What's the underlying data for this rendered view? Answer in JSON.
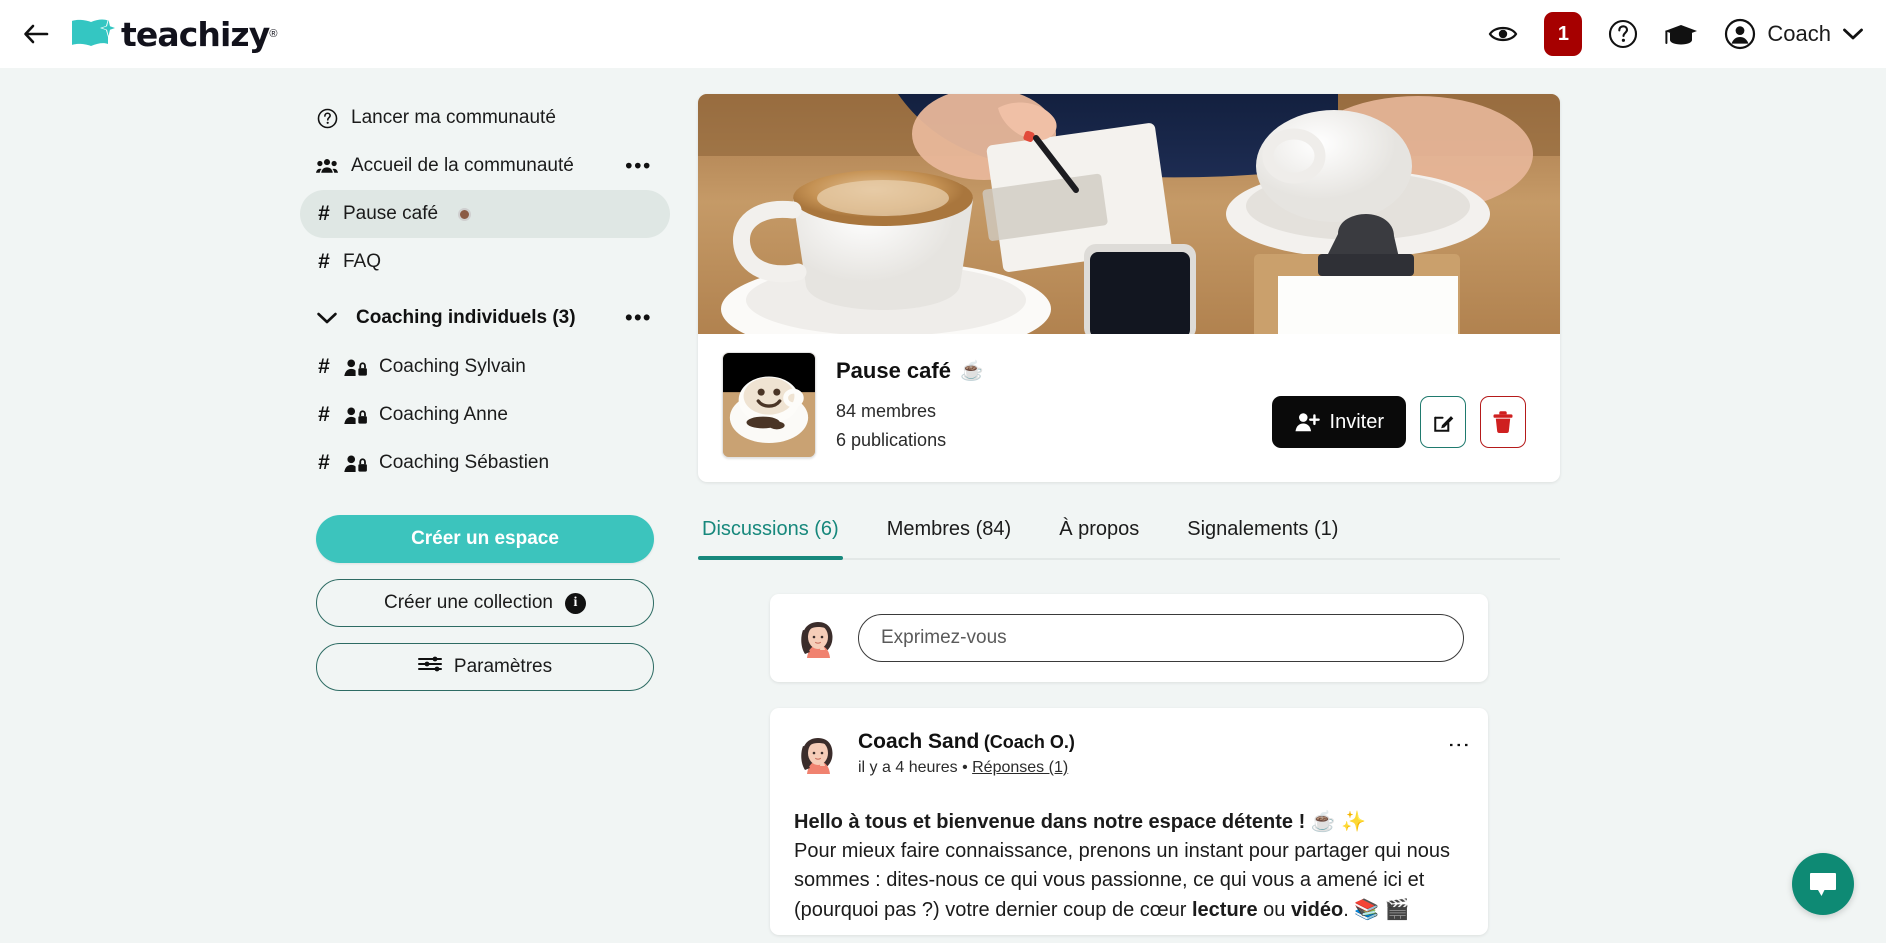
{
  "header": {
    "back_icon": "arrow-left-icon",
    "logo_text": "teachizy",
    "logo_registered": "®",
    "preview_icon": "eye-icon",
    "notification_count": "1",
    "help_icon": "question-circle-icon",
    "academy_icon": "graduation-cap-icon",
    "account_icon": "user-circle-icon",
    "account_name": "Coach",
    "chevron_icon": "chevron-down-icon"
  },
  "sidebar": {
    "items": [
      {
        "label": "Lancer ma communauté",
        "icon": "question-circle-icon",
        "type": "link",
        "active": false,
        "kebab": false
      },
      {
        "label": "Accueil de la communauté",
        "icon": "users-icon",
        "type": "link",
        "active": false,
        "kebab": true
      },
      {
        "label": "Pause café",
        "icon": "hash-icon",
        "type": "channel",
        "active": true,
        "kebab": false,
        "dot": true
      },
      {
        "label": "FAQ",
        "icon": "hash-icon",
        "type": "channel",
        "active": false,
        "kebab": false
      }
    ],
    "group": {
      "label": "Coaching individuels (3)",
      "chevron_icon": "chevron-down-icon",
      "kebab_icon": "kebab-icon",
      "children": [
        {
          "label": "Coaching Sylvain",
          "icon": "private-user-icon"
        },
        {
          "label": "Coaching Anne",
          "icon": "private-user-icon"
        },
        {
          "label": "Coaching Sébastien",
          "icon": "private-user-icon"
        }
      ]
    },
    "buttons": {
      "create_space": "Créer un espace",
      "create_collection": "Créer une collection",
      "collection_info_icon": "info-icon",
      "settings": "Paramètres",
      "settings_icon": "sliders-icon"
    }
  },
  "space": {
    "banner_alt": "coffee-cup-banner",
    "avatar_alt": "smiley-coffee-avatar",
    "title": "Pause café",
    "title_emoji": "☕",
    "members": "84 membres",
    "publications": "6 publications",
    "invite_button": "Inviter",
    "invite_icon": "user-plus-icon",
    "edit_icon": "pencil-square-icon",
    "delete_icon": "trash-icon"
  },
  "tabs": [
    {
      "label": "Discussions (6)",
      "active": true
    },
    {
      "label": "Membres (84)",
      "active": false
    },
    {
      "label": "À propos",
      "active": false
    },
    {
      "label": "Signalements (1)",
      "active": false
    }
  ],
  "composer": {
    "avatar_alt": "user-avatar",
    "placeholder": "Exprimez-vous",
    "value": ""
  },
  "post": {
    "avatar_alt": "coach-sand-avatar",
    "author": "Coach Sand",
    "role": "(Coach O.)",
    "time": "il y a 4 heures",
    "separator": "•",
    "replies_link": "Réponses (1)",
    "menu_icon": "kebab-vertical-icon",
    "body_line1_bold": "Hello à tous et bienvenue dans notre espace détente !",
    "body_line1_emoji": "☕ ✨",
    "body_rest_1": "Pour mieux faire connaissance, prenons un instant pour partager qui nous sommes : dites-nous ce qui vous passionne, ce qui vous a amené ici et (pourquoi pas ?) votre dernier coup de cœur ",
    "body_bold_1": "lecture",
    "body_rest_2": " ou ",
    "body_bold_2": "vidéo",
    "body_rest_3": ". 📚 🎬"
  },
  "chat": {
    "icon": "chat-bubble-icon"
  },
  "colors": {
    "brand_teal": "#3cc4bd",
    "accent_green": "#17887c",
    "danger_red": "#a60000",
    "delete_red": "#cf2020",
    "page_bg": "#f1f5f4",
    "active_item_bg": "#dfe7e4",
    "chat_fab": "#0e8a74"
  }
}
